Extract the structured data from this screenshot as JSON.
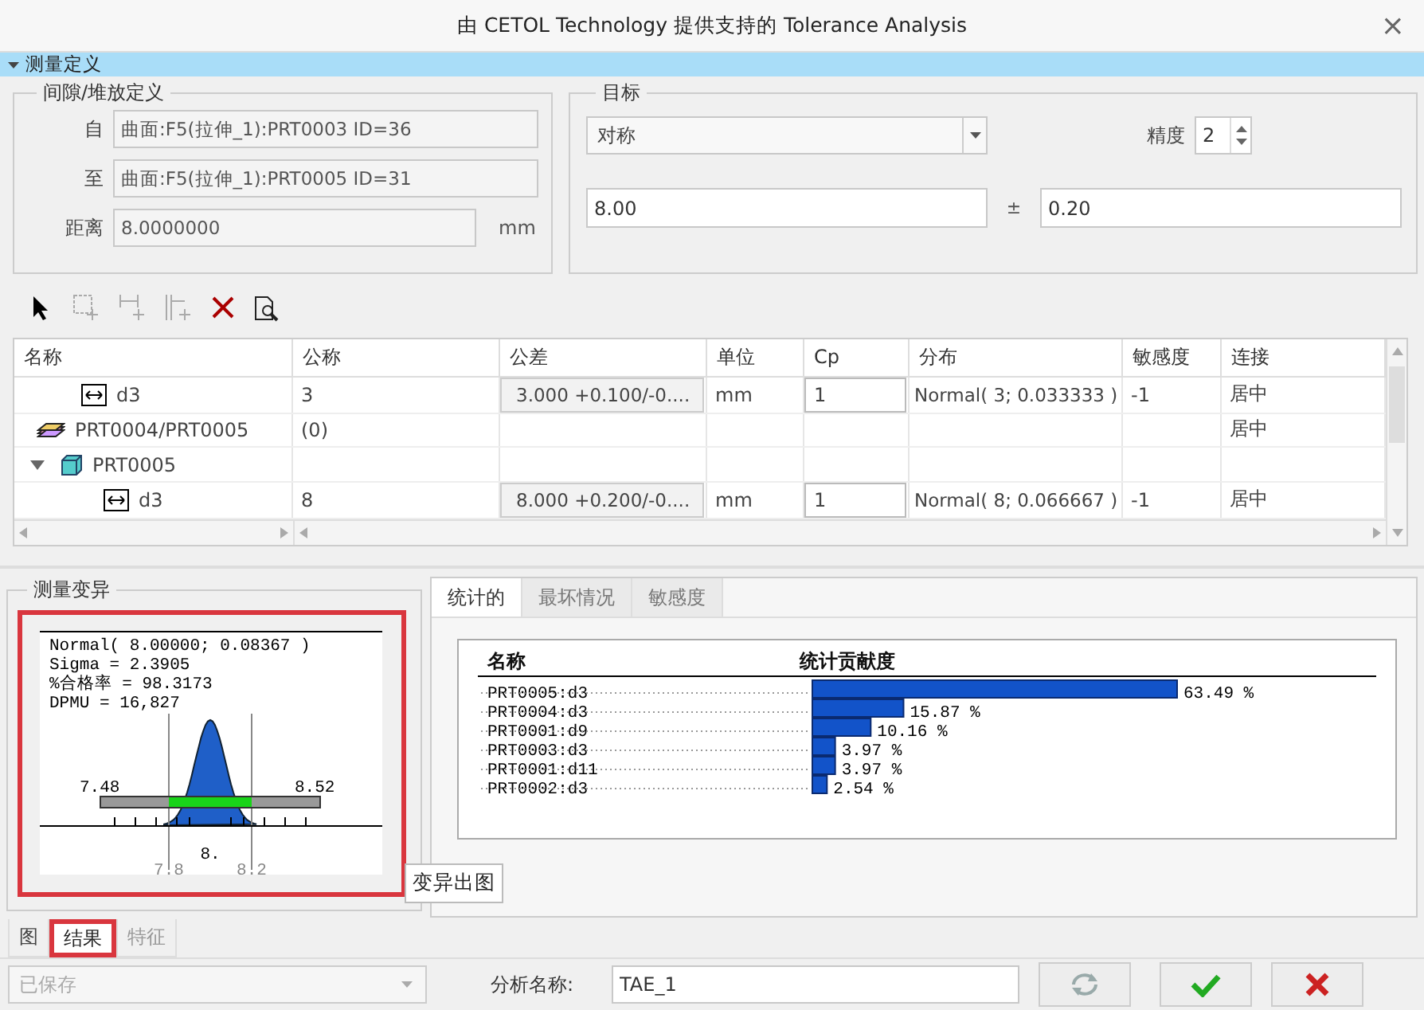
{
  "window": {
    "title": "由 CETOL Technology 提供支持的 Tolerance Analysis",
    "close": "×"
  },
  "section": {
    "label": "测量定义",
    "expanded": true
  },
  "gap_definition": {
    "title": "间隙/堆放定义",
    "fields": [
      {
        "label": "自",
        "value": "曲面:F5(拉伸_1):PRT0003 ID=36"
      },
      {
        "label": "至",
        "value": "曲面:F5(拉伸_1):PRT0005 ID=31"
      },
      {
        "label": "距离",
        "value": "8.0000000",
        "unit": "mm"
      }
    ]
  },
  "target": {
    "title": "目标",
    "type": "对称",
    "precision_label": "精度",
    "precision": "2",
    "nominal": "8.00",
    "pm": "±",
    "tolerance": "0.20"
  },
  "toolbar": [
    {
      "kind": "select",
      "disabled": false
    },
    {
      "kind": "add-box",
      "disabled": true
    },
    {
      "kind": "add-dimension",
      "disabled": true
    },
    {
      "kind": "add-chain",
      "disabled": true
    },
    {
      "kind": "delete",
      "disabled": false
    },
    {
      "kind": "preview",
      "disabled": false
    }
  ],
  "table": {
    "columns": [
      "名称",
      "公称",
      "公差",
      "单位",
      "Cp",
      "分布",
      "敏感度",
      "连接"
    ],
    "rows": [
      {
        "kind": "dimension",
        "name": "d3",
        "nominal": "3",
        "tolerance": "3.000 +0.100/-0....",
        "unit": "mm",
        "cp": "1",
        "distribution": "Normal( 3; 0.033333 )",
        "sensitivity": "-1",
        "connection": "居中"
      },
      {
        "kind": "assembly",
        "name": "PRT0004/PRT0005",
        "nominal": "(0)",
        "connection": "居中"
      },
      {
        "kind": "part",
        "name": "PRT0005",
        "expanded": true,
        "children": [
          {
            "kind": "dimension",
            "name": "d3",
            "nominal": "8",
            "tolerance": "8.000 +0.200/-0....",
            "unit": "mm",
            "cp": "1",
            "distribution": "Normal( 8; 0.066667 )",
            "sensitivity": "-1",
            "connection": "居中"
          }
        ]
      }
    ]
  },
  "variation": {
    "title": "测量变异",
    "highlighted": true,
    "stats": [
      "Normal( 8.00000; 0.08367 )",
      "Sigma  = 2.3905",
      "%合格率 = 98.3173",
      "DPMU   = 16,827"
    ],
    "lower_limit": "7.48",
    "upper_limit": "8.52",
    "axis_labels": [
      {
        "text": "7.8",
        "kind": "bound"
      },
      {
        "text": "8.",
        "kind": "center"
      },
      {
        "text": "8.2",
        "kind": "bound"
      }
    ],
    "tooltip": "变异出图"
  },
  "results": {
    "tabs": [
      {
        "label": "统计的",
        "selected": true
      },
      {
        "label": "最坏情况",
        "selected": false
      },
      {
        "label": "敏感度",
        "selected": false
      }
    ],
    "name_heading": "名称",
    "value_heading": "统计贡献度",
    "chart_data": {
      "type": "bar",
      "orientation": "horizontal",
      "categories": [
        "PRT0005:d3",
        "PRT0004:d3",
        "PRT0001:d9",
        "PRT0003:d3",
        "PRT0001:d11",
        "PRT0002:d3"
      ],
      "values": [
        63.49,
        15.87,
        10.16,
        3.97,
        3.97,
        2.54
      ],
      "value_labels": [
        "63.49 %",
        "15.87 %",
        "10.16 %",
        "3.97 %",
        "3.97 %",
        "2.54 %"
      ]
    }
  },
  "bottom_tabs": [
    {
      "label": "图",
      "selected": false,
      "highlighted": false,
      "disabled": false
    },
    {
      "label": "结果",
      "selected": true,
      "highlighted": true,
      "disabled": false
    },
    {
      "label": "特征",
      "selected": false,
      "highlighted": false,
      "disabled": true
    }
  ],
  "footer": {
    "saved": {
      "value": "已保存",
      "disabled": true
    },
    "name_label": "分析名称:",
    "name_value": "TAE_1",
    "refresh_disabled": true
  }
}
